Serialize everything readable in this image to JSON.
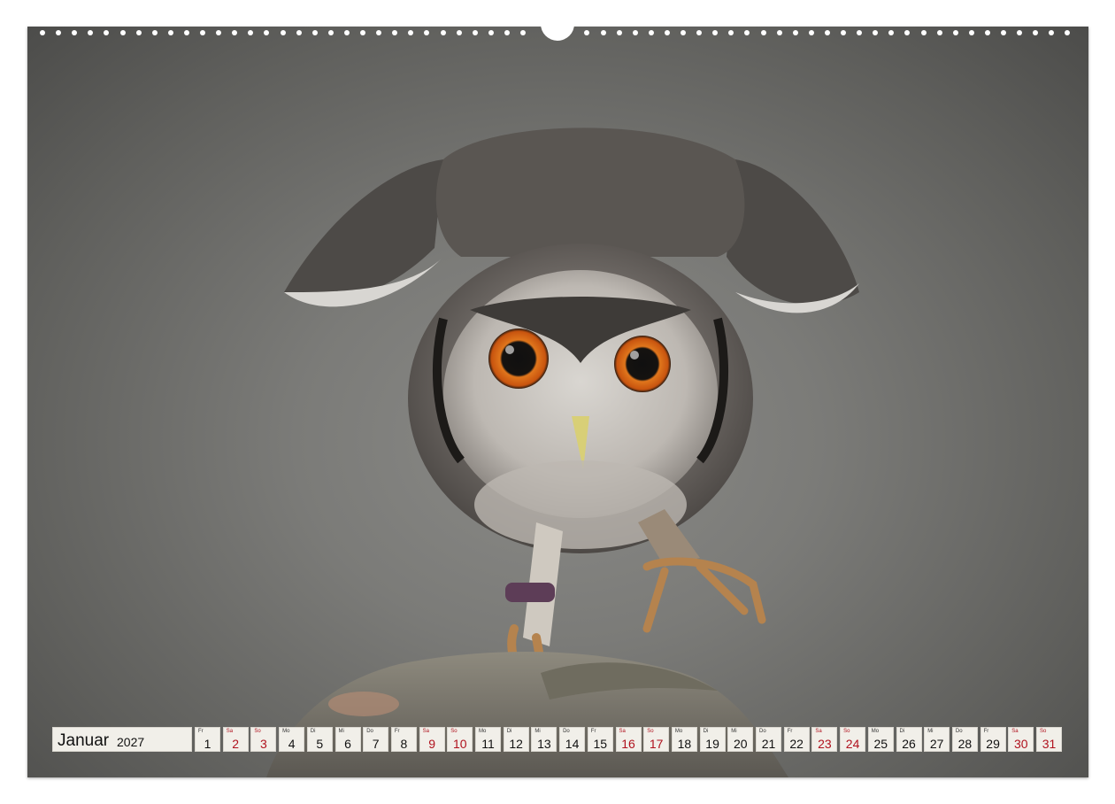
{
  "calendar": {
    "month": "Januar",
    "year": "2027",
    "weekend_color": "#b0121e",
    "days": [
      {
        "wd": "Fr",
        "n": "1",
        "weekend": false
      },
      {
        "wd": "Sa",
        "n": "2",
        "weekend": true
      },
      {
        "wd": "So",
        "n": "3",
        "weekend": true
      },
      {
        "wd": "Mo",
        "n": "4",
        "weekend": false
      },
      {
        "wd": "Di",
        "n": "5",
        "weekend": false
      },
      {
        "wd": "Mi",
        "n": "6",
        "weekend": false
      },
      {
        "wd": "Do",
        "n": "7",
        "weekend": false
      },
      {
        "wd": "Fr",
        "n": "8",
        "weekend": false
      },
      {
        "wd": "Sa",
        "n": "9",
        "weekend": true
      },
      {
        "wd": "So",
        "n": "10",
        "weekend": true
      },
      {
        "wd": "Mo",
        "n": "11",
        "weekend": false
      },
      {
        "wd": "Di",
        "n": "12",
        "weekend": false
      },
      {
        "wd": "Mi",
        "n": "13",
        "weekend": false
      },
      {
        "wd": "Do",
        "n": "14",
        "weekend": false
      },
      {
        "wd": "Fr",
        "n": "15",
        "weekend": false
      },
      {
        "wd": "Sa",
        "n": "16",
        "weekend": true
      },
      {
        "wd": "So",
        "n": "17",
        "weekend": true
      },
      {
        "wd": "Mo",
        "n": "18",
        "weekend": false
      },
      {
        "wd": "Di",
        "n": "19",
        "weekend": false
      },
      {
        "wd": "Mi",
        "n": "20",
        "weekend": false
      },
      {
        "wd": "Do",
        "n": "21",
        "weekend": false
      },
      {
        "wd": "Fr",
        "n": "22",
        "weekend": false
      },
      {
        "wd": "Sa",
        "n": "23",
        "weekend": true
      },
      {
        "wd": "So",
        "n": "24",
        "weekend": true
      },
      {
        "wd": "Mo",
        "n": "25",
        "weekend": false
      },
      {
        "wd": "Di",
        "n": "26",
        "weekend": false
      },
      {
        "wd": "Mi",
        "n": "27",
        "weekend": false
      },
      {
        "wd": "Do",
        "n": "28",
        "weekend": false
      },
      {
        "wd": "Fr",
        "n": "29",
        "weekend": false
      },
      {
        "wd": "Sa",
        "n": "30",
        "weekend": true
      },
      {
        "wd": "So",
        "n": "31",
        "weekend": true
      }
    ]
  },
  "photo": {
    "subject_icon": "owl-photo",
    "eye_color": "#e0761c",
    "background_color": "#7b7b78"
  }
}
